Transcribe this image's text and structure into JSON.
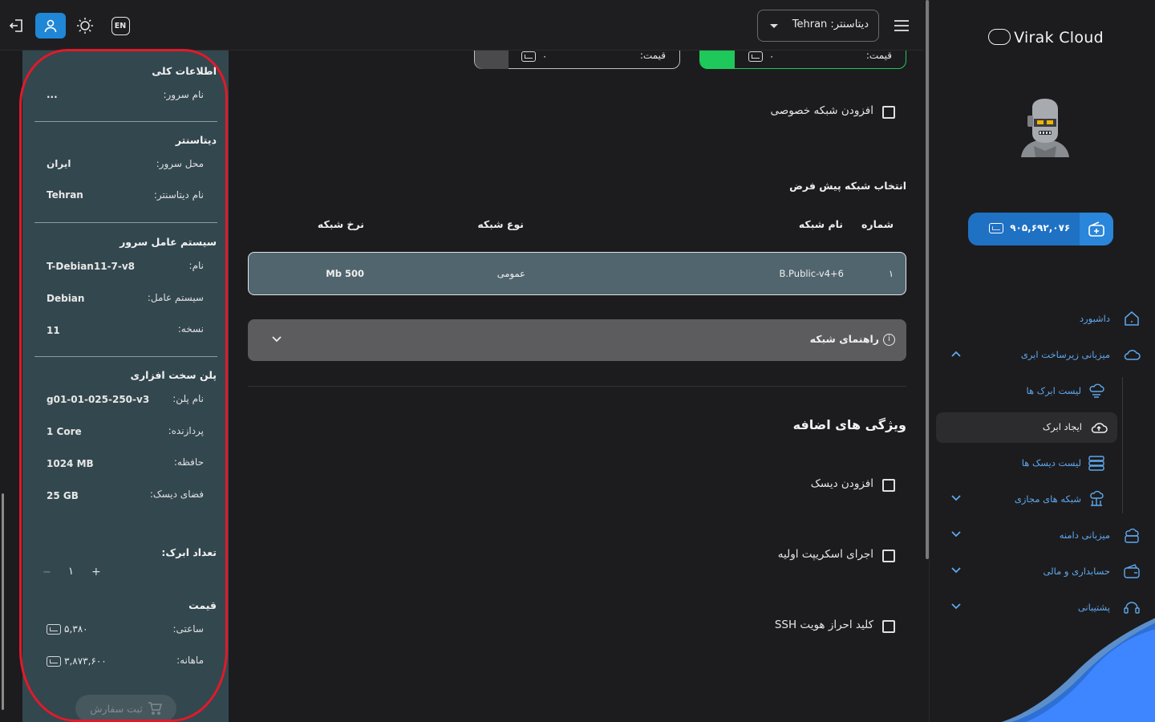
{
  "topbar": {
    "lang_label": "EN",
    "datacenter_label": "دیتاسنتر: Tehran"
  },
  "summary": {
    "general_title": "اطلاعات کلی",
    "server_name_label": "نام سرور:",
    "server_name_value": "...",
    "datacenter_title": "دیتاسنتر",
    "location_label": "محل سرور:",
    "location_value": "ایران",
    "dc_name_label": "نام دیتاسنتر:",
    "dc_name_value": "Tehran",
    "os_title": "سیستم عامل سرور",
    "os_name_label": "نام:",
    "os_name_value": "T-Debian11-7-v8",
    "os_label": "سیستم عامل:",
    "os_value": "Debian",
    "version_label": "نسخه:",
    "version_value": "11",
    "plan_title": "پلن سخت افزاری",
    "plan_name_label": "نام پلن:",
    "plan_name_value": "g01-01-025-250-v3",
    "cpu_label": "پردازنده:",
    "cpu_value": "1 Core",
    "ram_label": "حافظه:",
    "ram_value": "1024 MB",
    "disk_label": "فضای دیسک:",
    "disk_value": "25 GB",
    "count_title": "تعداد ابرک:",
    "count_value": "۱",
    "count_minus": "−",
    "count_plus": "+",
    "price_title": "قیمت",
    "hourly_label": "ساعتی:",
    "hourly_value": "۵,۳۸۰",
    "monthly_label": "ماهانه:",
    "monthly_value": "۳,۸۷۳,۶۰۰",
    "order_button": "ثبت سفارش"
  },
  "main": {
    "price_label_1": "قیمت:",
    "price_value_1": "۰",
    "price_label_2": "قیمت:",
    "price_value_2": "۰",
    "private_network_label": "افزودن شبکه خصوصی",
    "default_network_title": "انتخاب شبکه پیش فرض",
    "table_headers": [
      "شماره",
      "نام شبکه",
      "نوع شبکه",
      "نرخ شبکه"
    ],
    "network_row": {
      "number": "۱",
      "name": "B.Public-v4+6",
      "type": "عمومی",
      "rate": "500 Mb"
    },
    "network_guide": "راهنمای شبکه",
    "extras_title": "ویژگی های اضافه",
    "add_disk_label": "افزودن دیسک",
    "init_script_label": "اجرای اسکریپت اولیه",
    "ssh_key_label": "کلید احراز هویت SSH"
  },
  "sidebar": {
    "brand": "Virak Cloud",
    "balance": "۹۰۵,۶۹۲,۰۷۶",
    "items": [
      {
        "label": "داشبورد"
      },
      {
        "label": "میزبانی زیرساخت ابری"
      },
      {
        "label": "لیست ابرک ها"
      },
      {
        "label": "ایجاد ابرک"
      },
      {
        "label": "لیست دیسک ها"
      },
      {
        "label": "شبکه های مجازی"
      },
      {
        "label": "میزبانی دامنه"
      },
      {
        "label": "حسابداری و مالی"
      },
      {
        "label": "پشتیبانی"
      }
    ]
  },
  "colors": {
    "accent": "#1f87d6",
    "active_price": "#1fc85a",
    "panel": "#33474f",
    "highlight": "#e01a2a"
  }
}
